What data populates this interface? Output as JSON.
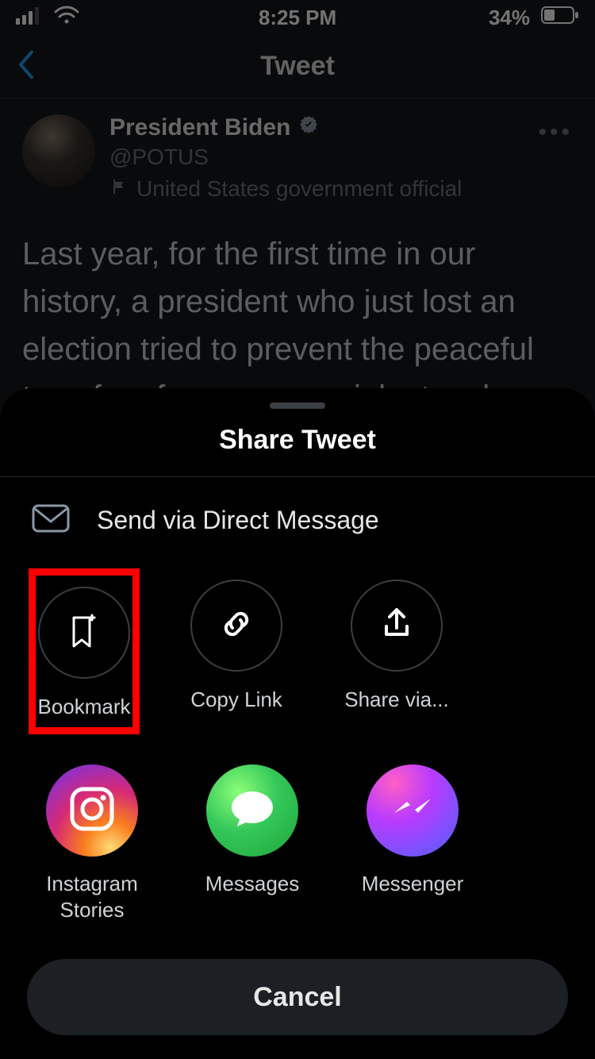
{
  "status": {
    "time": "8:25 PM",
    "battery": "34%"
  },
  "nav": {
    "title": "Tweet"
  },
  "tweet": {
    "name": "President Biden",
    "handle": "@POTUS",
    "gov_label": "United States government official",
    "text": "Last year, for the first time in our history, a president who just lost an election tried to prevent the peaceful transfer of power as a violent mob"
  },
  "sheet": {
    "title": "Share Tweet",
    "dm_label": "Send via Direct Message",
    "actions": {
      "bookmark": "Bookmark",
      "copy_link": "Copy Link",
      "share_via": "Share via..."
    },
    "apps": {
      "instagram_stories": "Instagram Stories",
      "messages": "Messages",
      "messenger": "Messenger"
    },
    "cancel": "Cancel"
  }
}
